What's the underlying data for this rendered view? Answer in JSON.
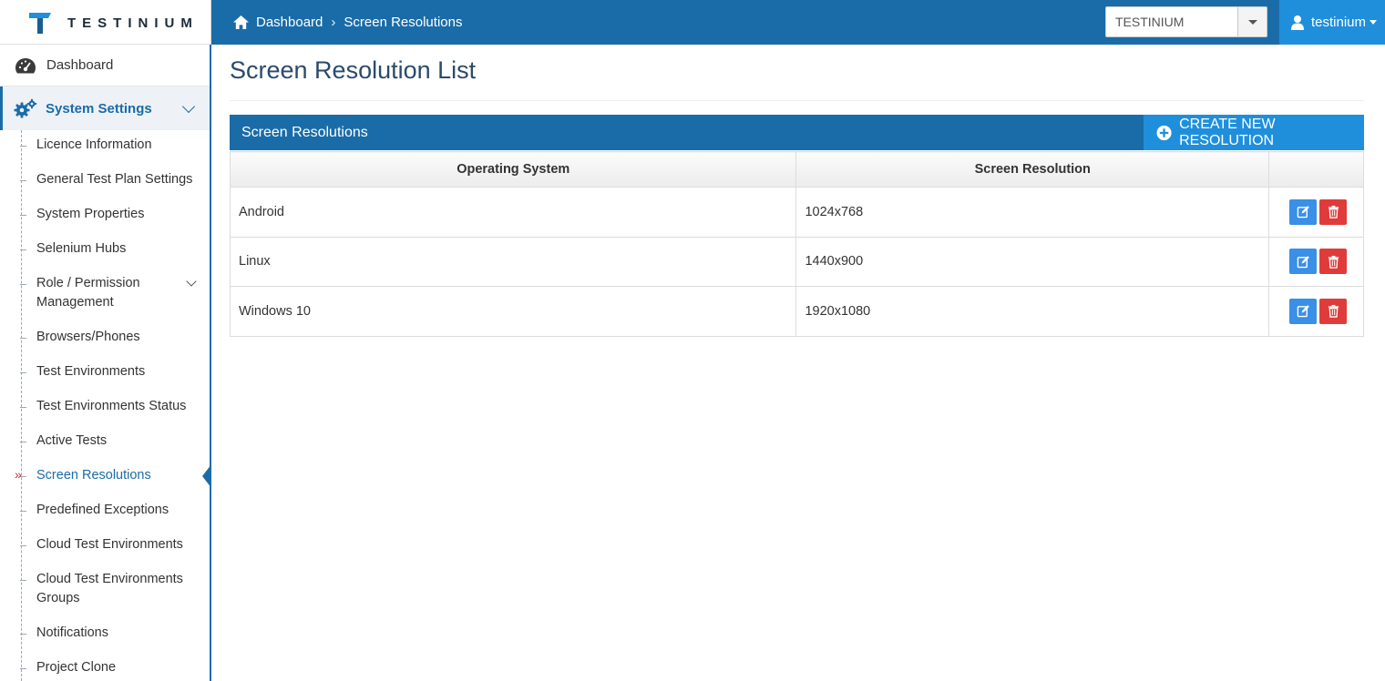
{
  "brand": {
    "name": "TESTINIUM",
    "accent": "#1a6ca8"
  },
  "breadcrumb": {
    "home": "Dashboard",
    "current": "Screen Resolutions"
  },
  "project_select": {
    "value": "TESTINIUM"
  },
  "user": {
    "name": "testinium"
  },
  "sidebar": {
    "dashboard": "Dashboard",
    "section": "System Settings",
    "items": [
      {
        "label": "Licence Information"
      },
      {
        "label": "General Test Plan Settings"
      },
      {
        "label": "System Properties"
      },
      {
        "label": "Selenium Hubs"
      },
      {
        "label": "Role / Permission Management"
      },
      {
        "label": "Browsers/Phones"
      },
      {
        "label": "Test Environments"
      },
      {
        "label": "Test Environments Status"
      },
      {
        "label": "Active Tests"
      },
      {
        "label": "Screen Resolutions"
      },
      {
        "label": "Predefined Exceptions"
      },
      {
        "label": "Cloud Test Environments"
      },
      {
        "label": "Cloud Test Environments Groups"
      },
      {
        "label": "Notifications"
      },
      {
        "label": "Project Clone"
      }
    ],
    "active_index": 9,
    "active_marker": "»"
  },
  "main": {
    "title": "Screen Resolution List",
    "panel_title": "Screen Resolutions",
    "create_label": "CREATE NEW RESOLUTION",
    "columns": [
      "Operating System",
      "Screen Resolution",
      ""
    ],
    "rows": [
      {
        "os": "Android",
        "resolution": "1024x768"
      },
      {
        "os": "Linux",
        "resolution": "1440x900"
      },
      {
        "os": "Windows 10",
        "resolution": "1920x1080"
      }
    ]
  }
}
